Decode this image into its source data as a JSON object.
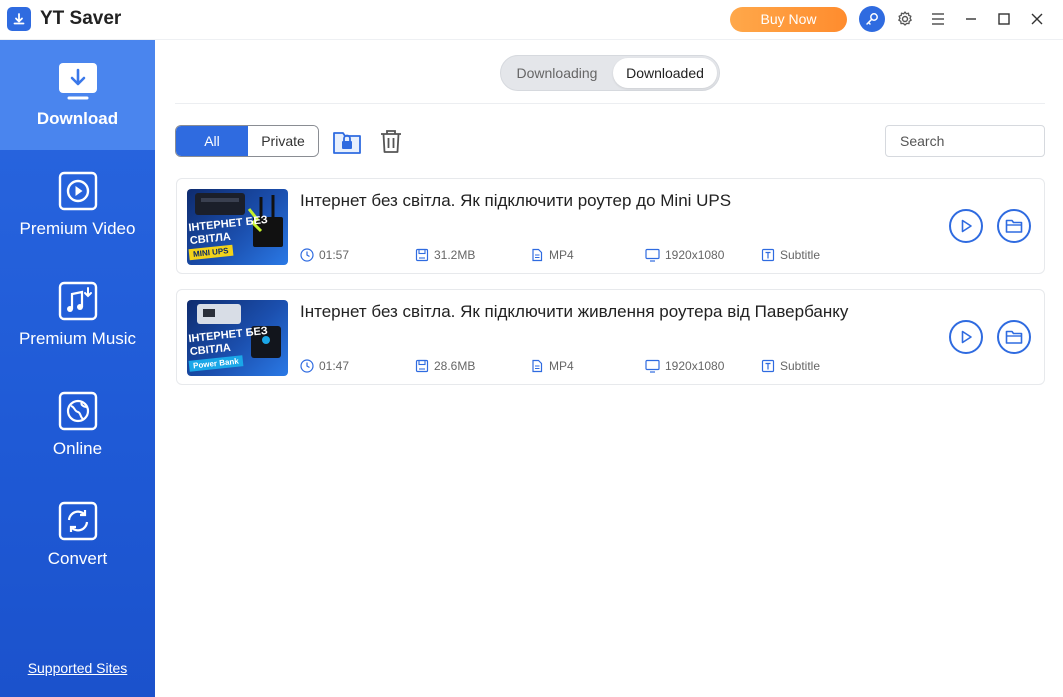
{
  "app": {
    "title": "YT Saver",
    "buy_label": "Buy Now"
  },
  "sidebar": {
    "items": [
      {
        "label": "Download",
        "icon": "download-icon"
      },
      {
        "label": "Premium Video",
        "icon": "play-circle-icon"
      },
      {
        "label": "Premium Music",
        "icon": "music-icon"
      },
      {
        "label": "Online",
        "icon": "globe-icon"
      },
      {
        "label": "Convert",
        "icon": "convert-icon"
      }
    ],
    "active": "Download",
    "supported_sites": "Supported Sites"
  },
  "tabs": {
    "downloading": "Downloading",
    "downloaded": "Downloaded",
    "active": "Downloaded"
  },
  "filters": {
    "all": "All",
    "private": "Private",
    "active": "All"
  },
  "search": {
    "placeholder": "Search"
  },
  "colors": {
    "accent": "#2f6be0",
    "buy": "#ff9a3c"
  },
  "items": [
    {
      "title": "Інтернет без світла. Як підключити роутер до Mini UPS",
      "duration": "01:57",
      "size": "31.2MB",
      "format": "MP4",
      "resolution": "1920x1080",
      "subtitle": "Subtitle",
      "thumb_text": "ІНТЕРНЕТ БЕЗ СВІТЛА",
      "thumb_tag": "MINI UPS"
    },
    {
      "title": "Інтернет без світла. Як підключити живлення роутера від Павербанку",
      "duration": "01:47",
      "size": "28.6MB",
      "format": "MP4",
      "resolution": "1920x1080",
      "subtitle": "Subtitle",
      "thumb_text": "ІНТЕРНЕТ БЕЗ СВІТЛА",
      "thumb_tag": "Power Bank"
    }
  ]
}
